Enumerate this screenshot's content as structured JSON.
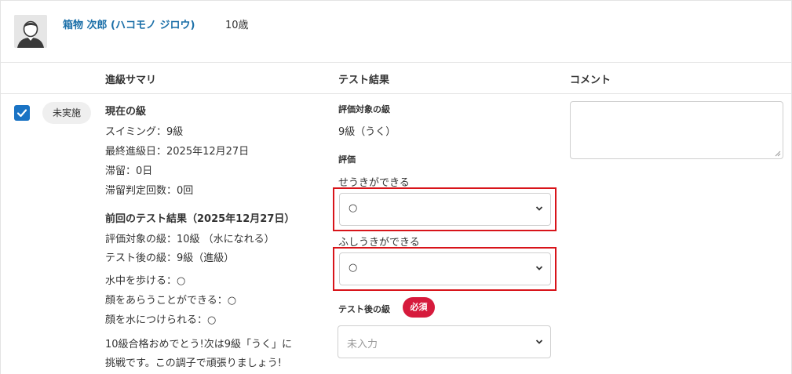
{
  "student": {
    "name": "箱物 次郎 (ハコモノ ジロウ)",
    "age": "10歳"
  },
  "columns": {
    "summary": "進級サマリ",
    "results": "テスト結果",
    "comment": "コメント"
  },
  "row": {
    "checked": true,
    "status": "未実施"
  },
  "summary": {
    "current_heading": "現在の級",
    "current_lines": [
      "スイミング：9級",
      "最終進級日：2025年12月27日",
      "滞留：0日",
      "滞留判定回数：0回"
    ],
    "previous_heading": "前回のテスト結果（2025年12月27日）",
    "previous_lines": [
      "評価対象の級：10級 （水になれる）",
      "テスト後の級：9級（進級）"
    ],
    "item_lines": [
      "水中を歩ける：○",
      "顔をあらうことができる：○",
      "顔を水につけられる：○"
    ],
    "message_lines": [
      "10級合格おめでとう!次は9級「うく」に",
      "挑戦です。この調子で頑張りましょう!"
    ]
  },
  "results": {
    "target_label": "評価対象の級",
    "target_value": "9級（うく）",
    "evaluation_label": "評価",
    "item1_label": "せうきができる",
    "item1_value": "○",
    "item2_label": "ふしうきができる",
    "item2_value": "○",
    "after_label": "テスト後の級",
    "required_badge": "必須",
    "after_placeholder": "未入力"
  },
  "comment": {
    "value": ""
  },
  "colors": {
    "accent": "#1a73c4",
    "name_link": "#1b6fa8",
    "highlight": "#d8141a",
    "required": "#d61a3c"
  }
}
